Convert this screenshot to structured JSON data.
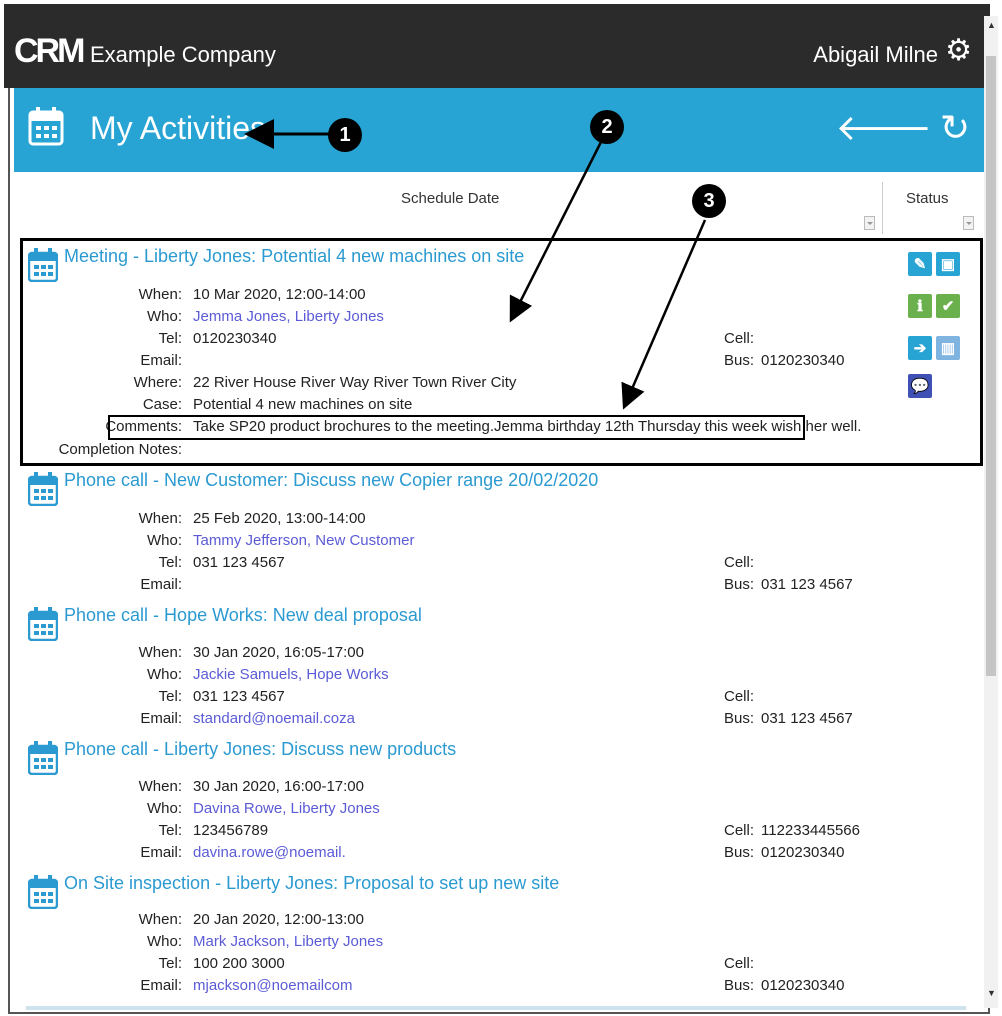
{
  "header": {
    "logo": "CRM",
    "company": "Example Company",
    "user": "Abigail Milne",
    "icons": [
      "gear-icon"
    ]
  },
  "subheader": {
    "title": "My Activities",
    "icons": [
      "calendar-icon",
      "back-arrow-icon",
      "refresh-icon"
    ]
  },
  "columns": {
    "schedule": "Schedule Date",
    "status": "Status"
  },
  "labels": {
    "when": "When:",
    "who": "Who:",
    "tel": "Tel:",
    "email": "Email:",
    "where": "Where:",
    "case": "Case:",
    "comments": "Comments:",
    "completion": "Completion Notes:",
    "cell": "Cell:",
    "bus": "Bus:"
  },
  "activities": [
    {
      "title": "Meeting - Liberty Jones: Potential 4 new machines on site",
      "when": "10 Mar 2020, 12:00-14:00",
      "who": "Jemma Jones, Liberty Jones",
      "tel": "0120230340",
      "email": "",
      "where": "22 River House River Way River Town River City",
      "case": "Potential 4 new machines on site",
      "comments": "Take SP20 product brochures to the meeting.Jemma birthday 12th Thursday this week wish her well.",
      "completion": "",
      "cell": "",
      "bus": "0120230340"
    },
    {
      "title": "Phone call - New Customer: Discuss new Copier range 20/02/2020",
      "when": "25 Feb 2020, 13:00-14:00",
      "who": "Tammy Jefferson, New Customer",
      "tel": "031 123 4567",
      "email": "",
      "cell": "",
      "bus": "031 123 4567"
    },
    {
      "title": "Phone call - Hope Works: New deal proposal",
      "when": "30 Jan 2020, 16:05-17:00",
      "who": "Jackie Samuels, Hope Works",
      "tel": "031 123 4567",
      "email": "standard@noemail.coza",
      "cell": "",
      "bus": "031 123 4567"
    },
    {
      "title": "Phone call - Liberty Jones: Discuss new products",
      "when": "30 Jan 2020, 16:00-17:00",
      "who": "Davina Rowe, Liberty Jones",
      "tel": "123456789",
      "email": "davina.rowe@noemail.",
      "cell": "112233445566",
      "bus": "0120230340"
    },
    {
      "title": "On Site inspection - Liberty Jones: Proposal to set up new site",
      "when": "20 Jan 2020, 12:00-13:00",
      "who": "Mark Jackson, Liberty Jones",
      "tel": "100 200 3000",
      "email": "mjackson@noemailcom",
      "cell": "",
      "bus": "0120230340"
    }
  ],
  "status_icons": [
    {
      "name": "edit-icon",
      "color": "#27a4d3"
    },
    {
      "name": "calendar-icon",
      "color": "#27a4d3"
    },
    {
      "name": "info-icon",
      "color": "#6ab04c"
    },
    {
      "name": "checkmark-icon",
      "color": "#6ab04c"
    },
    {
      "name": "forward-arrow-icon",
      "color": "#27a4d3"
    },
    {
      "name": "building-icon",
      "color": "#7fb3e0"
    },
    {
      "name": "chat-icon",
      "color": "#3f51b5"
    }
  ],
  "callouts": [
    "1",
    "2",
    "3"
  ],
  "colors": {
    "topbar": "#2b2b2b",
    "subbar": "#27a4d3",
    "title_link": "#2b9ad1",
    "person_link": "#5b5bd6"
  }
}
